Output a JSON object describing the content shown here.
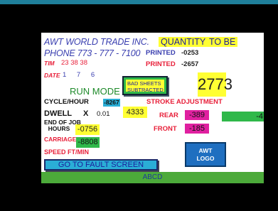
{
  "header": {
    "company": "AWT WORLD TRADE INC.",
    "phone": "PHONE 773 - 777 - 7100",
    "quantity_label": "QUANTITY",
    "tobe_label": "TO BE"
  },
  "printed": {
    "label": "PRINTED",
    "value1": "-0253",
    "value2": "-2657"
  },
  "time": {
    "label": "TIM",
    "value": "23 38 38"
  },
  "date": {
    "label": "DATE",
    "value": "1 7 6"
  },
  "run_mode": "RUN MODE",
  "bad_sheets": {
    "line1": "BAD SHEETS",
    "line2": "SUBTRACTED",
    "value": "2773"
  },
  "cycle": {
    "label": "CYCLE/HOUR",
    "value": "-8267"
  },
  "stroke_adjustment": "STROKE ADJUSTMENT",
  "dwell": {
    "label": "DWELL",
    "x": "X",
    "factor": "0.01",
    "value": "4333"
  },
  "rear": {
    "label": "REAR",
    "value": "-389"
  },
  "right_value": "-4",
  "end_of_job": {
    "line1": "END OF JOB",
    "line2": "HOURS",
    "value": "-0756"
  },
  "front": {
    "label": "FRONT",
    "value": "-185"
  },
  "carriage": {
    "label": "CARRIAGE",
    "value": "-8808"
  },
  "speed": "SPEED FT/MIN",
  "logo": {
    "line1": "AWT",
    "line2": "LOGO"
  },
  "fault_button": "GO TO FAULT SCREEN",
  "status_bar": "ABCD",
  "colors": {
    "panel_bg": "#ffffff",
    "highlight_yellow": "#ffff33",
    "green": "#2fb84a",
    "magenta": "#e020a0",
    "cyan": "#2aaed6",
    "red_text": "#e8203a",
    "blue_text": "#3a3fb0"
  }
}
